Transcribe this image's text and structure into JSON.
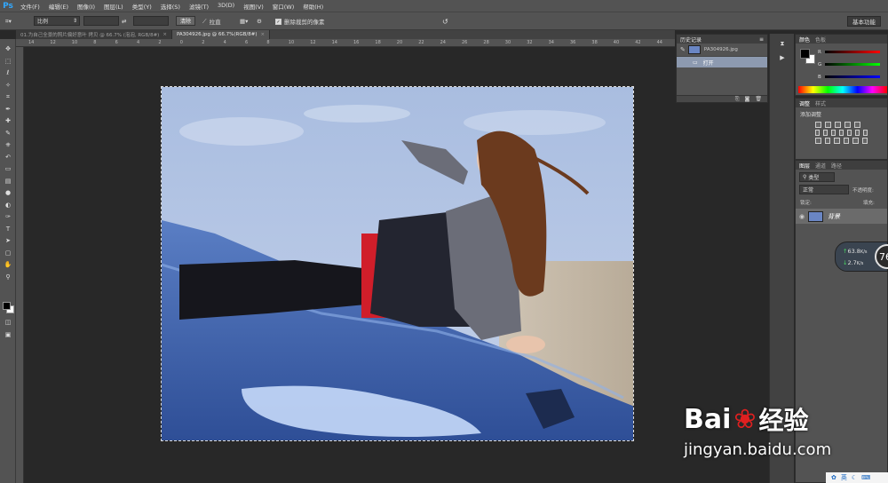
{
  "app": {
    "logo": "Ps"
  },
  "menu": [
    "文件(F)",
    "编辑(E)",
    "图像(I)",
    "图层(L)",
    "类型(Y)",
    "选择(S)",
    "滤镜(T)",
    "3D(D)",
    "视图(V)",
    "窗口(W)",
    "帮助(H)"
  ],
  "options": {
    "ratio_select": "比例",
    "clear_button": "清除",
    "straighten_label": "拉直",
    "delete_cropped_label": "删除裁剪的像素",
    "workspace_button": "基本功能"
  },
  "tabs": [
    {
      "label": "01.为自己全景的照片偏好意叶 拷贝 @ 66.7% (泡泡, RGB/8#)",
      "active": false
    },
    {
      "label": "PA304926.jpg @ 66.7%(RGB/8#)",
      "active": true
    }
  ],
  "ruler_ticks": [
    "14",
    "12",
    "10",
    "8",
    "6",
    "4",
    "2",
    "0",
    "2",
    "4",
    "6",
    "8",
    "10",
    "12",
    "14",
    "16",
    "18",
    "20",
    "22",
    "24",
    "26",
    "28",
    "30",
    "32",
    "34",
    "36",
    "38",
    "40",
    "42",
    "44"
  ],
  "history": {
    "title": "历史记录",
    "snapshot": "PA304926.jpg",
    "items": [
      "打开"
    ]
  },
  "color_panel": {
    "tabs": [
      "颜色",
      "色板"
    ],
    "channels": [
      "R",
      "G",
      "B"
    ],
    "colors": {
      "foreground": "#000000",
      "background": "#ffffff"
    }
  },
  "adjustments": {
    "tabs": [
      "调整",
      "样式"
    ],
    "title": "添加调整"
  },
  "layers": {
    "tabs": [
      "图层",
      "通道",
      "路径"
    ],
    "kind_label": "类型",
    "blend_mode": "正常",
    "opacity_label": "不透明度:",
    "lock_label": "锁定:",
    "fill_label": "填充:",
    "layer_name": "背景"
  },
  "net_widget": {
    "up": "63.8",
    "up_unit": "K/s",
    "down": "2.7",
    "down_unit": "K/s",
    "badge": "76"
  },
  "watermark": {
    "brand_a": "Bai",
    "brand_b": "经验",
    "url": "jingyan.baidu.com"
  },
  "ime_label": "英"
}
